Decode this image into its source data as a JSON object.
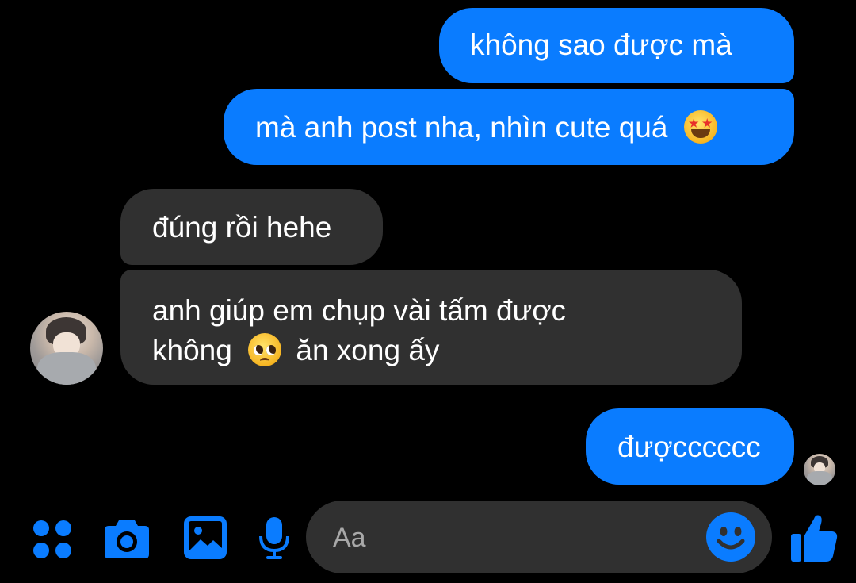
{
  "colors": {
    "background": "#000000",
    "outgoing_bubble": "#0a7cff",
    "incoming_bubble": "#303030",
    "accent": "#0a7cff",
    "text": "#ffffff",
    "placeholder": "#a8a8a8"
  },
  "messages": [
    {
      "direction": "outgoing",
      "text": "không sao được mà"
    },
    {
      "direction": "outgoing",
      "text": "mà anh post nha, nhìn cute quá",
      "emoji": "star-struck-emoji"
    },
    {
      "direction": "incoming",
      "text": "đúng rồi hehe"
    },
    {
      "direction": "incoming",
      "line1": "anh giúp em chụp vài tấm được",
      "line2_before": "không",
      "line2_emoji": "pleading-face-emoji",
      "line2_after": "ăn xong ấy"
    },
    {
      "direction": "outgoing",
      "text": "đượcccccc",
      "seen": true
    }
  ],
  "composer": {
    "placeholder": "Aa",
    "icons": [
      "apps-icon",
      "camera-icon",
      "gallery-icon",
      "microphone-icon",
      "emoji-icon",
      "thumbs-up-icon"
    ]
  }
}
